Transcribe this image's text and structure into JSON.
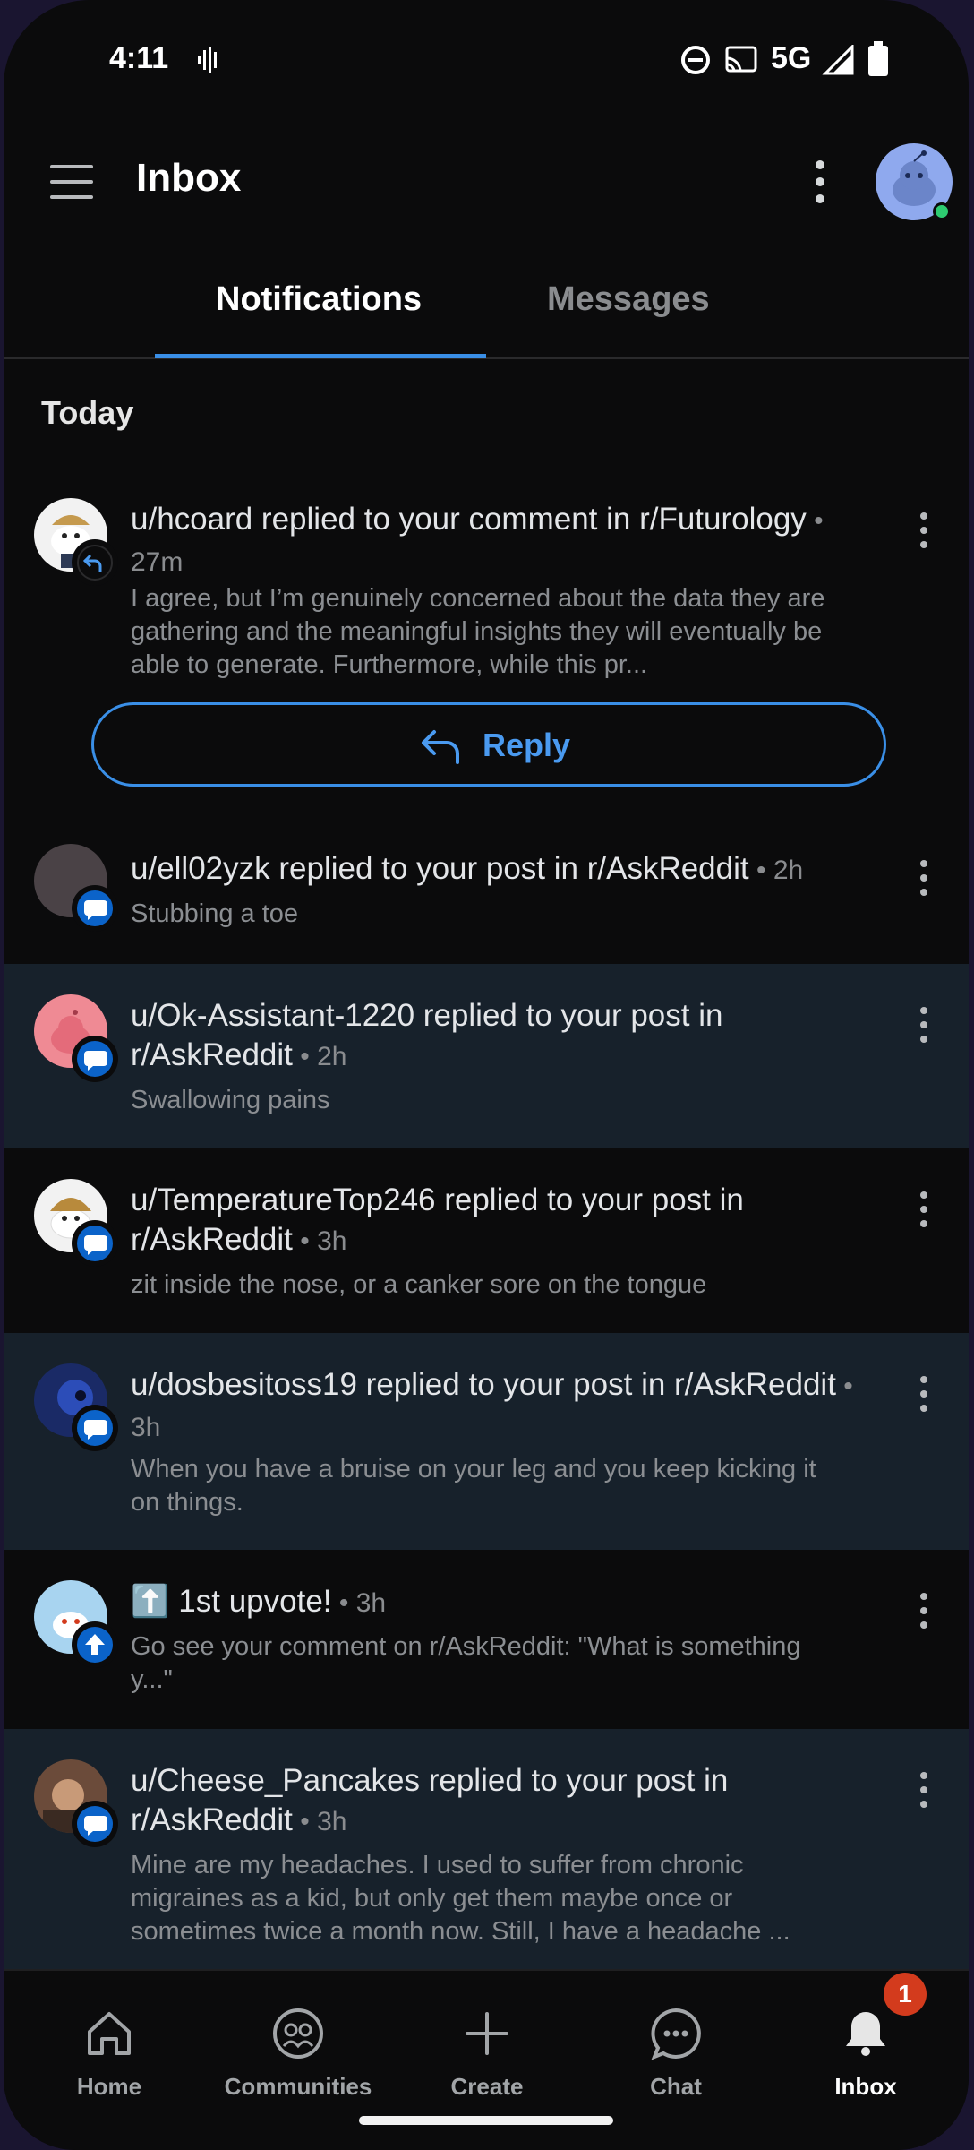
{
  "status_bar": {
    "time": "4:11",
    "network": "5G"
  },
  "appbar": {
    "title": "Inbox"
  },
  "tabs": [
    {
      "label": "Notifications",
      "active": true
    },
    {
      "label": "Messages",
      "active": false
    }
  ],
  "section": {
    "heading": "Today"
  },
  "reply_button": {
    "label": "Reply"
  },
  "notifications": [
    {
      "title": "u/hcoard replied to your comment in r/Futurology",
      "time": "27m",
      "body": "I agree, but I’m genuinely concerned about the data they are gathering and the meaningful insights they will eventually be able to generate. Furthermore, while this pr...",
      "badge_icon": "reply-icon",
      "unread": false
    },
    {
      "title": "u/ell02yzk replied to your post in r/AskReddit",
      "time": "2h",
      "body": "Stubbing a toe",
      "badge_icon": "comment-icon",
      "unread": false
    },
    {
      "title": "u/Ok-Assistant-1220 replied to your post in r/AskReddit",
      "time": "2h",
      "body": "Swallowing pains",
      "badge_icon": "comment-icon",
      "unread": true
    },
    {
      "title": "u/TemperatureTop246 replied to your post in r/AskReddit",
      "time": "3h",
      "body": "zit inside the nose, or a canker sore on the tongue",
      "badge_icon": "comment-icon",
      "unread": false
    },
    {
      "title": "u/dosbesitoss19 replied to your post in r/AskReddit",
      "time": "3h",
      "body": "When you have a bruise on your leg and you keep kicking it on things.",
      "badge_icon": "comment-icon",
      "unread": true
    },
    {
      "title": "⬆️ 1st upvote!",
      "time": "3h",
      "body": "Go see your comment on r/AskReddit: \"What is something y...\"",
      "badge_icon": "upvote-icon",
      "unread": false
    },
    {
      "title": "u/Cheese_Pancakes replied to your post in r/AskReddit",
      "time": "3h",
      "body": "Mine are my headaches.  I used to suffer from chronic migraines as a kid, but only get them maybe once or sometimes twice a month now.  Still, I have a headache ...",
      "badge_icon": "comment-icon",
      "unread": true
    }
  ],
  "bottom_nav": [
    {
      "label": "Home",
      "icon": "home-icon"
    },
    {
      "label": "Communities",
      "icon": "communities-icon"
    },
    {
      "label": "Create",
      "icon": "plus-icon"
    },
    {
      "label": "Chat",
      "icon": "chat-icon"
    },
    {
      "label": "Inbox",
      "icon": "bell-icon",
      "active": true,
      "badge": "1"
    }
  ],
  "colors": {
    "accent": "#3a8fe7",
    "unread_bg": "#17212b",
    "badge": "#d33b1d"
  }
}
